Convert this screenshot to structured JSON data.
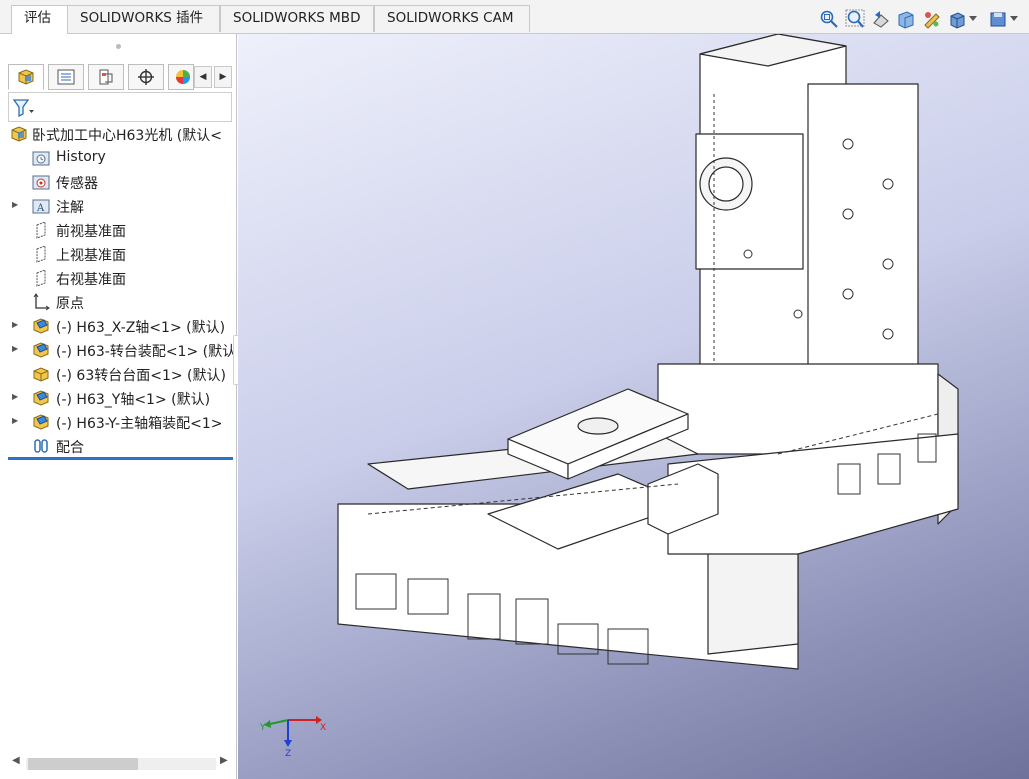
{
  "tabs": [
    {
      "label": "评估",
      "active": true
    },
    {
      "label": "SOLIDWORKS 插件",
      "active": false
    },
    {
      "label": "SOLIDWORKS MBD",
      "active": false
    },
    {
      "label": "SOLIDWORKS CAM",
      "active": false
    }
  ],
  "manager_tabs": [
    "feature-manager",
    "property-manager",
    "configuration-manager",
    "dimxpert-manager",
    "display-manager"
  ],
  "tree": {
    "root": "卧式加工中心H63光机  (默认<",
    "items": [
      {
        "label": "History",
        "icon": "history-folder-icon"
      },
      {
        "label": "传感器",
        "icon": "sensor-folder-icon"
      },
      {
        "label": "注解",
        "icon": "annotation-folder-icon",
        "expandable": true
      },
      {
        "label": "前视基准面",
        "icon": "plane-icon"
      },
      {
        "label": "上视基准面",
        "icon": "plane-icon"
      },
      {
        "label": "右视基准面",
        "icon": "plane-icon"
      },
      {
        "label": "原点",
        "icon": "origin-icon"
      },
      {
        "label": "(-) H63_X-Z轴<1> (默认)",
        "icon": "subassembly-icon",
        "expandable": true
      },
      {
        "label": "(-) H63-转台装配<1> (默认",
        "icon": "subassembly-icon",
        "expandable": true
      },
      {
        "label": "(-) 63转台台面<1> (默认)",
        "icon": "part-icon"
      },
      {
        "label": "(-) H63_Y轴<1> (默认)",
        "icon": "subassembly-icon",
        "expandable": true
      },
      {
        "label": "(-) H63-Y-主轴箱装配<1>",
        "icon": "subassembly-icon",
        "expandable": true
      },
      {
        "label": "配合",
        "icon": "mates-icon"
      }
    ]
  },
  "heads_up_toolbar": [
    "zoom-to-fit-icon",
    "zoom-to-area-icon",
    "previous-view-icon",
    "section-view-icon",
    "view-orientation-icon",
    "display-style-icon",
    "view-settings-icon"
  ],
  "triad": {
    "x": "X",
    "y": "Y",
    "z": "Z"
  },
  "colors": {
    "accent": "#2a73c6",
    "viewport_top": "#eef0fb",
    "viewport_bottom": "#6f729a"
  }
}
